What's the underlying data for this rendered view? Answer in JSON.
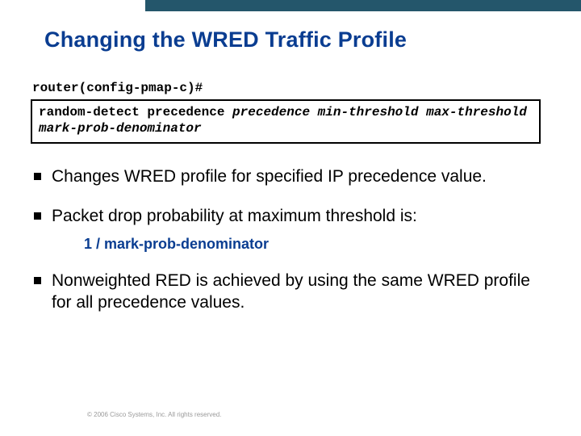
{
  "title": "Changing the WRED Traffic Profile",
  "prompt": "router(config-pmap-c)#",
  "code": {
    "plain": "random-detect precedence ",
    "italic1": "precedence min-threshold max-threshold",
    "italic2": "mark-prob-denominator"
  },
  "bullets": [
    {
      "text": "Changes WRED profile for specified IP precedence value."
    },
    {
      "text": "Packet drop probability at maximum threshold is:",
      "formula": "1 / mark-prob-denominator"
    },
    {
      "text": "Nonweighted RED is achieved by using the same WRED profile for all precedence values."
    }
  ],
  "copyright": "© 2006 Cisco Systems, Inc. All rights reserved."
}
